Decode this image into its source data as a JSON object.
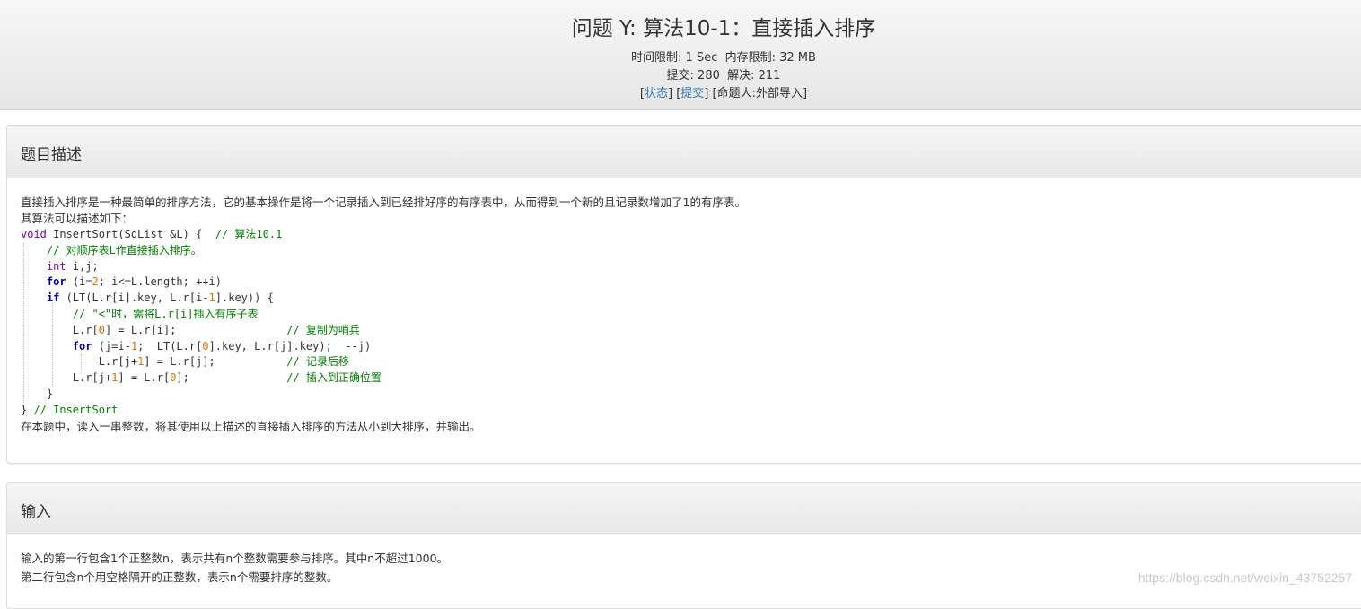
{
  "problem": {
    "title": "问题 Y: 算法10-1：直接插入排序",
    "time_limit": "时间限制: 1 Sec",
    "memory_limit": "内存限制: 32 MB",
    "submit_count": "提交: 280",
    "solved_count": "解决: 211",
    "links": {
      "status": "状态",
      "submit": "提交",
      "author": "[命题人:外部导入]"
    }
  },
  "description": {
    "heading": "题目描述",
    "line1": "直接插入排序是一种最简单的排序方法，它的基本操作是将一个记录插入到已经排好序的有序表中，从而得到一个新的且记录数增加了1的有序表。",
    "line2": "其算法可以描述如下：",
    "code": {
      "l1_kw": "void",
      "l1_text": " InsertSort(SqList &L) {  ",
      "l1_cm": "// 算法10.1",
      "l2_cm": "// 对顺序表L作直接插入排序。",
      "l3_kw": "int",
      "l3_text": " i,j;",
      "l4_kw": "for",
      "l4_a": " (i=",
      "l4_n": "2",
      "l4_b": "; i<=L.length; ++i)",
      "l5_kw": "if",
      "l5_a": " (LT(L.r[i].key, L.r[i-",
      "l5_n": "1",
      "l5_b": "].key)) {",
      "l6_cm": "// \"<\"时，需将L.r[i]插入有序子表",
      "l7_a": "L.r[",
      "l7_n": "0",
      "l7_b": "] = L.r[i];",
      "l7_cm": "// 复制为哨兵",
      "l8_kw": "for",
      "l8_a": " (j=i-",
      "l8_n1": "1",
      "l8_b": ";  LT(L.r[",
      "l8_n2": "0",
      "l8_c": "].key, L.r[j].key);  --j)",
      "l9_a": "L.r[j+",
      "l9_n": "1",
      "l9_b": "] = L.r[j];",
      "l9_cm": "// 记录后移",
      "l10_a": "L.r[j+",
      "l10_n1": "1",
      "l10_b": "] = L.r[",
      "l10_n2": "0",
      "l10_c": "];",
      "l10_cm": "// 插入到正确位置",
      "l11": "}",
      "l12_a": "} ",
      "l12_cm": "// InsertSort"
    },
    "line3": "在本题中，读入一串整数，将其使用以上描述的直接插入排序的方法从小到大排序，并输出。"
  },
  "input": {
    "heading": "输入",
    "line1": "输入的第一行包含1个正整数n，表示共有n个整数需要参与排序。其中n不超过1000。",
    "line2": "第二行包含n个用空格隔开的正整数，表示n个需要排序的整数。"
  },
  "watermark": "https://blog.csdn.net/weixin_43752257",
  "colors": {
    "link": "#337ab7",
    "keyword": "#7f0055",
    "comment": "#008000",
    "number": "#e07000"
  }
}
